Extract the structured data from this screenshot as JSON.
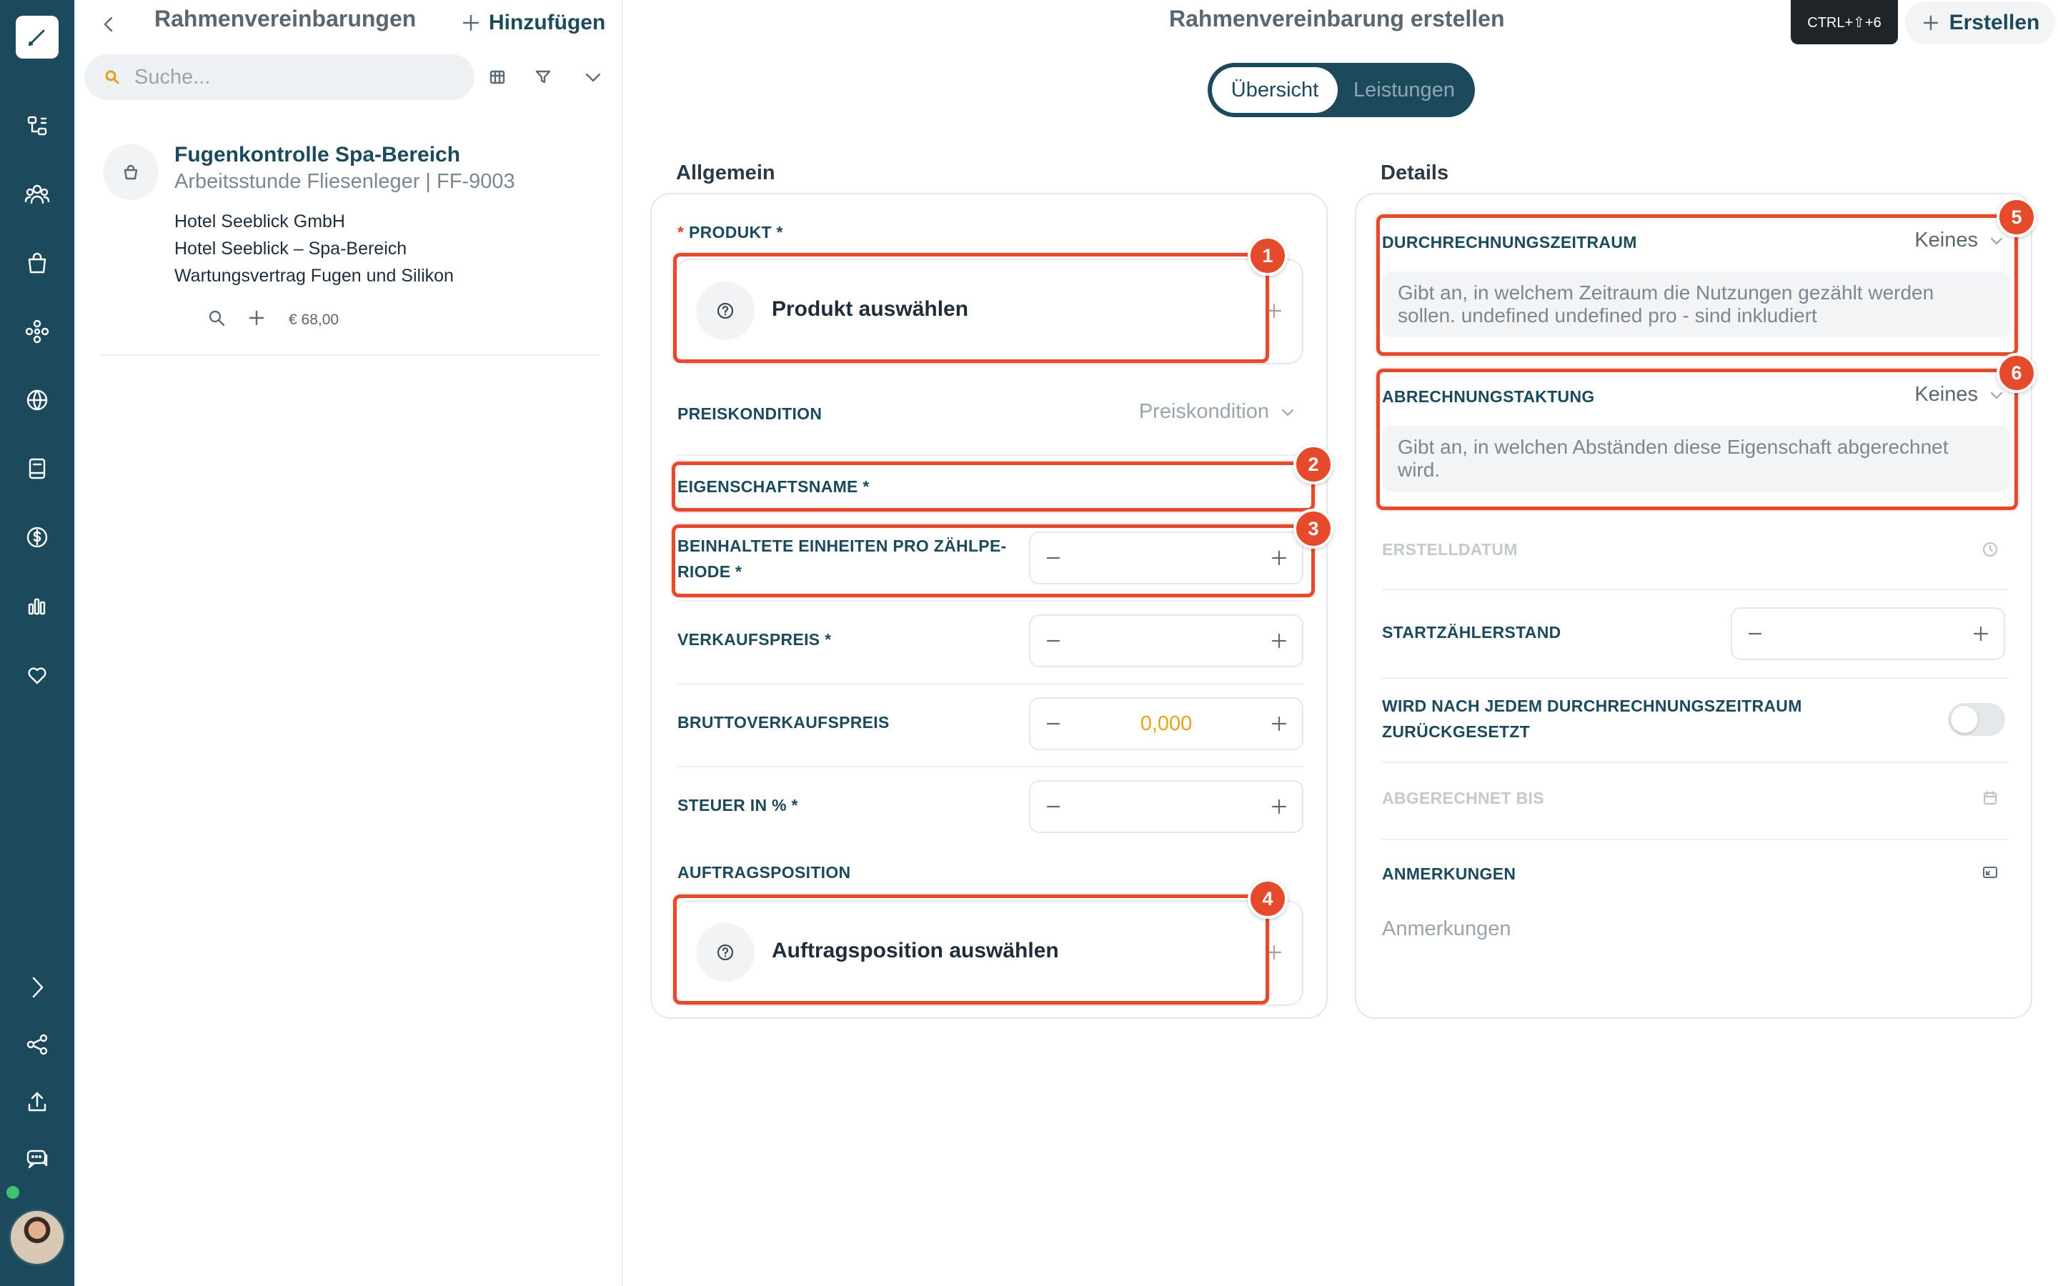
{
  "left_panel": {
    "title": "Rahmenvereinbarungen",
    "add_label": "Hinzufügen",
    "search_placeholder": "Suche...",
    "items": [
      {
        "title": "Fugenkontrolle Spa-Bereich",
        "subtitle": "Arbeitsstunde Fliesenleger | FF-9003",
        "line1": "Hotel Seeblick GmbH",
        "line2": "Hotel Seeblick – Spa-Bereich",
        "line3": "Wartungsvertrag Fugen und Silikon",
        "price": "€ 68,00"
      }
    ]
  },
  "header": {
    "title": "Rahmenvereinbarung erstellen",
    "shortcut": "CTRL+⇧+6",
    "create_label": "Erstellen"
  },
  "tabs": [
    {
      "label": "Übersicht",
      "active": true
    },
    {
      "label": "Leistungen",
      "active": false
    }
  ],
  "general": {
    "section_label": "Allgemein",
    "produkt_label": "PRODUKT *",
    "produkt_placeholder": "Produkt auswählen",
    "preiskondition_label": "PREISKONDITION",
    "preiskondition_placeholder": "Preiskondition",
    "eigenschaftsname_label": "EIGENSCHAFTSNAME *",
    "einheiten_label_1": "BEINHALTETE EINHEITEN PRO ZÄHLPE-",
    "einheiten_label_2": "RIODE *",
    "verkaufspreis_label": "VERKAUFSPREIS *",
    "bruttoverkaufspreis_label": "BRUTTOVERKAUFSPREIS",
    "bruttoverkaufspreis_value": "0,000",
    "steuer_label": "STEUER IN % *",
    "auftragsposition_label": "AUFTRAGSPOSITION",
    "auftragsposition_placeholder": "Auftragsposition auswählen"
  },
  "details": {
    "section_label": "Details",
    "durchrechnung_label": "DURCHRECHNUNGSZEITRAUM",
    "durchrechnung_value": "Keines",
    "durchrechnung_hint": "Gibt an, in welchem Zeitraum die Nutzungen gezählt werden sollen. undefined undefined pro - sind inkludiert",
    "abrechnung_label": "ABRECHNUNGSTAKTUNG",
    "abrechnung_value": "Keines",
    "abrechnung_hint": "Gibt an, in welchen Abständen diese Eigenschaft abgerechnet wird.",
    "erstelldatum_label": "ERSTELLDATUM",
    "startzaehler_label": "STARTZÄHLERSTAND",
    "reset_label_1": "WIRD NACH JEDEM DURCHRECHNUNGSZEITRAUM",
    "reset_label_2": "ZURÜCKGESETZT",
    "reset_enabled": false,
    "abgerechnet_label": "ABGERECHNET BIS",
    "anmerkungen_label": "ANMERKUNGEN",
    "anmerkungen_placeholder": "Anmerkungen"
  },
  "annotations": [
    "1",
    "2",
    "3",
    "4",
    "5",
    "6"
  ],
  "colors": {
    "rail": "#1c4a5c",
    "accent": "#1c4a5c",
    "highlight": "#e54a2c",
    "value_orange": "#e8a317"
  }
}
